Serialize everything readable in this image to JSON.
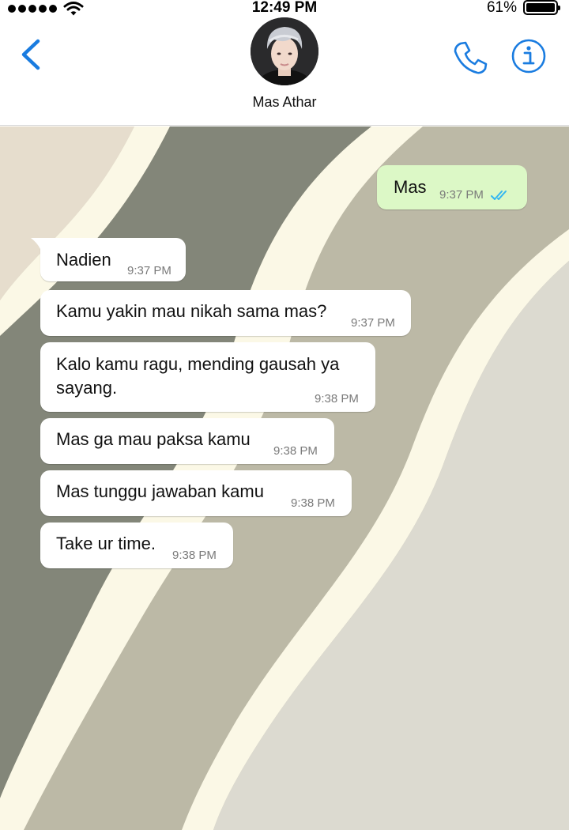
{
  "status_bar": {
    "time": "12:49 PM",
    "battery": "61%"
  },
  "header": {
    "contact_name": "Mas Athar"
  },
  "messages": [
    {
      "direction": "out",
      "text": "Mas",
      "time": "9:37 PM",
      "status": "read"
    },
    {
      "direction": "in",
      "text": "Nadien",
      "time": "9:37 PM"
    },
    {
      "direction": "in",
      "text": "Kamu yakin mau nikah sama mas?",
      "time": "9:37 PM"
    },
    {
      "direction": "in",
      "text": "Kalo kamu ragu, mending gausah ya sayang.",
      "time": "9:38 PM"
    },
    {
      "direction": "in",
      "text": "Mas ga mau paksa kamu",
      "time": "9:38 PM"
    },
    {
      "direction": "in",
      "text": "Mas tunggu jawaban kamu",
      "time": "9:38 PM"
    },
    {
      "direction": "in",
      "text": "Take ur time.",
      "time": "9:38 PM"
    }
  ],
  "colors": {
    "accent": "#1a7ce0",
    "outgoing_bubble": "#dcf8c6",
    "incoming_bubble": "#ffffff",
    "read_ticks": "#34b7f1"
  },
  "icons": {
    "back": "chevron-left-icon",
    "call": "phone-icon",
    "info": "info-icon",
    "read_status": "double-check-icon"
  }
}
